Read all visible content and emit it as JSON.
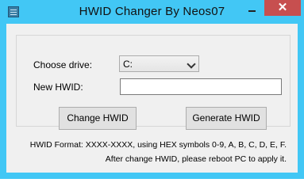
{
  "window": {
    "title": "HWID Changer By Neos07",
    "close_glyph": "✕",
    "accent_color": "#42c7f5",
    "close_color": "#c74f4f"
  },
  "form": {
    "drive_label": "Choose drive:",
    "drive_value": "C:",
    "hwid_label": "New HWID:",
    "hwid_value": "",
    "change_button": "Change HWID",
    "generate_button": "Generate HWID"
  },
  "info": {
    "line1": "HWID Format: XXXX-XXXX, using HEX symbols 0-9, A, B, C, D, E, F.",
    "line2": "After change HWID, please reboot PC to apply it."
  }
}
